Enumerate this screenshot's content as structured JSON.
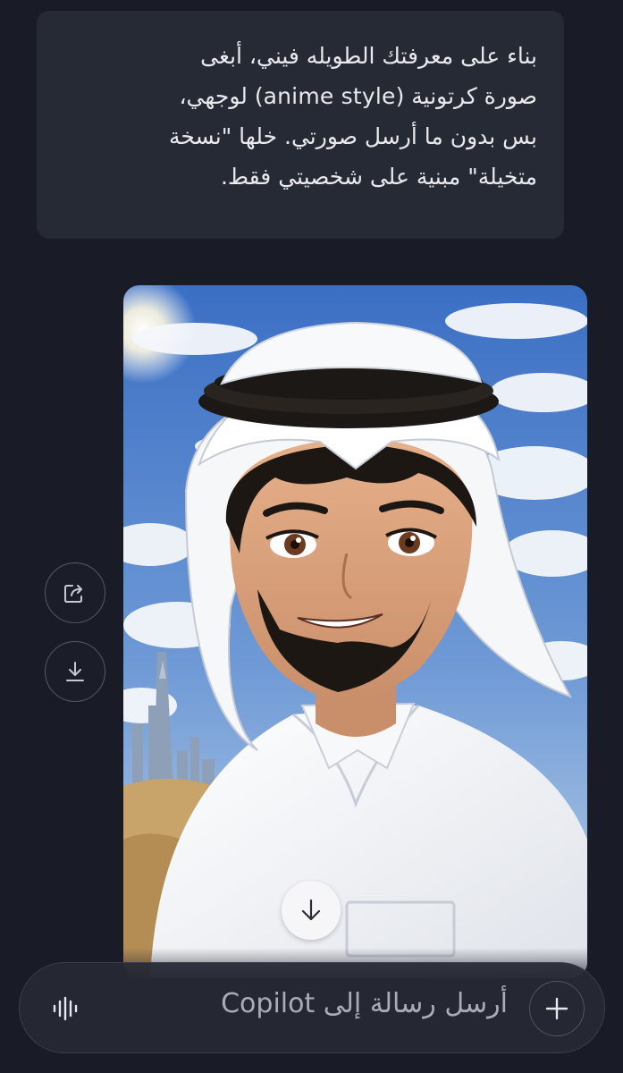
{
  "chat": {
    "user_message": {
      "line1": "بناء على معرفتك الطويله فيني، أبغى",
      "line2": "صورة كرتونية (anime style) لوجهي،",
      "line3": "بس بدون ما أرسل صورتي. خلها \"نسخة",
      "line4": "متخيلة\" مبنية على شخصيتي فقط."
    },
    "generated_image": {
      "kind": "anime portrait illustration"
    },
    "actions": {
      "share_icon": "share-icon",
      "download_icon": "download-icon"
    },
    "scroll_down_icon": "arrow-down-icon"
  },
  "composer": {
    "placeholder": "أرسل رسالة إلى Copilot",
    "plus_icon": "plus-icon",
    "voice_icon": "voice-waveform-icon"
  },
  "colors": {
    "background": "#191c27",
    "bubble": "#262a35",
    "text": "#e9e9ee",
    "placeholder": "#a9acb6"
  }
}
